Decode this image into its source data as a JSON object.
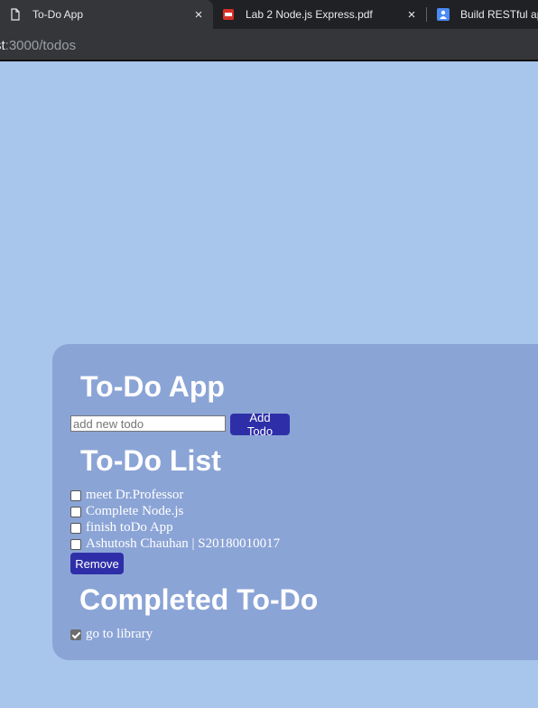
{
  "browser": {
    "tabs": [
      {
        "label": "To-Do App",
        "close": "×"
      },
      {
        "label": "Lab 2 Node.js Express.pdf",
        "close": "×"
      },
      {
        "label": "Build RESTful api"
      }
    ],
    "url_host": "st",
    "url_path": ":3000/todos"
  },
  "app": {
    "title": "To-Do App",
    "new_todo_placeholder": "add new todo",
    "add_button": "Add Todo",
    "list_heading": "To-Do List",
    "todos": [
      {
        "text": "meet Dr.Professor",
        "checked": false
      },
      {
        "text": "Complete Node.js",
        "checked": false
      },
      {
        "text": "finish toDo App",
        "checked": false
      },
      {
        "text": "Ashutosh Chauhan | S20180010017",
        "checked": false
      }
    ],
    "remove_button": "Remove",
    "completed_heading": "Completed To-Do",
    "completed": [
      {
        "text": "go to library",
        "checked": true
      }
    ]
  },
  "colors": {
    "page_bg": "#a8c6ec",
    "card_bg": "#8ba4d6",
    "button_bg": "#2e2fa8"
  }
}
